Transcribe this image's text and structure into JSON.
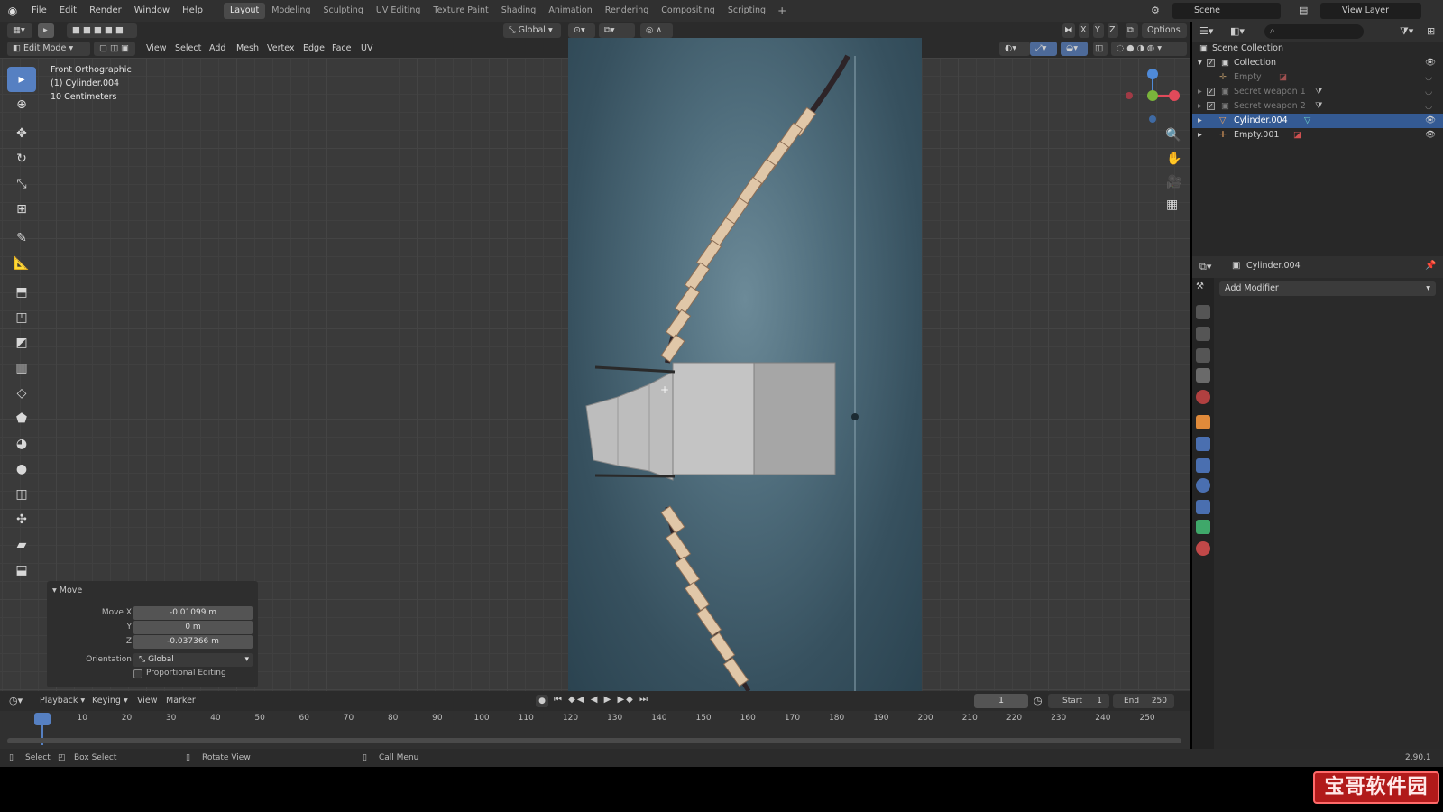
{
  "topbar": {
    "menus": [
      "File",
      "Edit",
      "Render",
      "Window",
      "Help"
    ],
    "workspaces": [
      "Layout",
      "Modeling",
      "Sculpting",
      "UV Editing",
      "Texture Paint",
      "Shading",
      "Animation",
      "Rendering",
      "Compositing",
      "Scripting"
    ],
    "active_workspace": "Layout",
    "scene": "Scene",
    "view_layer": "View Layer"
  },
  "viewport_header": {
    "mode": "Edit Mode",
    "menus": [
      "View",
      "Select",
      "Add",
      "Mesh",
      "Vertex",
      "Edge",
      "Face",
      "UV"
    ],
    "transform_orientation": "Global",
    "options_label": "Options",
    "axes": [
      "X",
      "Y",
      "Z"
    ]
  },
  "viewport_info": {
    "view_name": "Front Orthographic",
    "object": "(1) Cylinder.004",
    "scale": "10 Centimeters"
  },
  "operator_panel": {
    "title": "Move",
    "move_x_label": "Move X",
    "move_x": "-0.01099 m",
    "y_label": "Y",
    "y": "0 m",
    "z_label": "Z",
    "z": "-0.037366 m",
    "orientation_label": "Orientation",
    "orientation": "Global",
    "proportional_editing": "Proportional Editing"
  },
  "outliner": {
    "root": "Scene Collection",
    "items": [
      {
        "name": "Collection"
      },
      {
        "name": "Empty"
      },
      {
        "name": "Secret weapon 1"
      },
      {
        "name": "Secret weapon 2"
      },
      {
        "name": "Cylinder.004"
      },
      {
        "name": "Empty.001"
      }
    ]
  },
  "properties": {
    "object_name": "Cylinder.004",
    "add_modifier": "Add Modifier"
  },
  "timeline": {
    "menus": [
      "Playback",
      "Keying",
      "View",
      "Marker"
    ],
    "current_frame": "1",
    "start_label": "Start",
    "start": "1",
    "end_label": "End",
    "end": "250",
    "frame_labels": [
      "1",
      "10",
      "20",
      "30",
      "40",
      "50",
      "60",
      "70",
      "80",
      "90",
      "100",
      "110",
      "120",
      "130",
      "140",
      "150",
      "160",
      "170",
      "180",
      "190",
      "200",
      "210",
      "220",
      "230",
      "240",
      "250"
    ]
  },
  "statusbar": {
    "select": "Select",
    "box_select": "Box Select",
    "rotate_view": "Rotate View",
    "call_menu": "Call Menu",
    "version": "2.90.1"
  },
  "watermark": "宝哥软件园",
  "colors": {
    "accent": "#5680c2",
    "selection": "#345a93",
    "bone": "#e0c7a8"
  }
}
